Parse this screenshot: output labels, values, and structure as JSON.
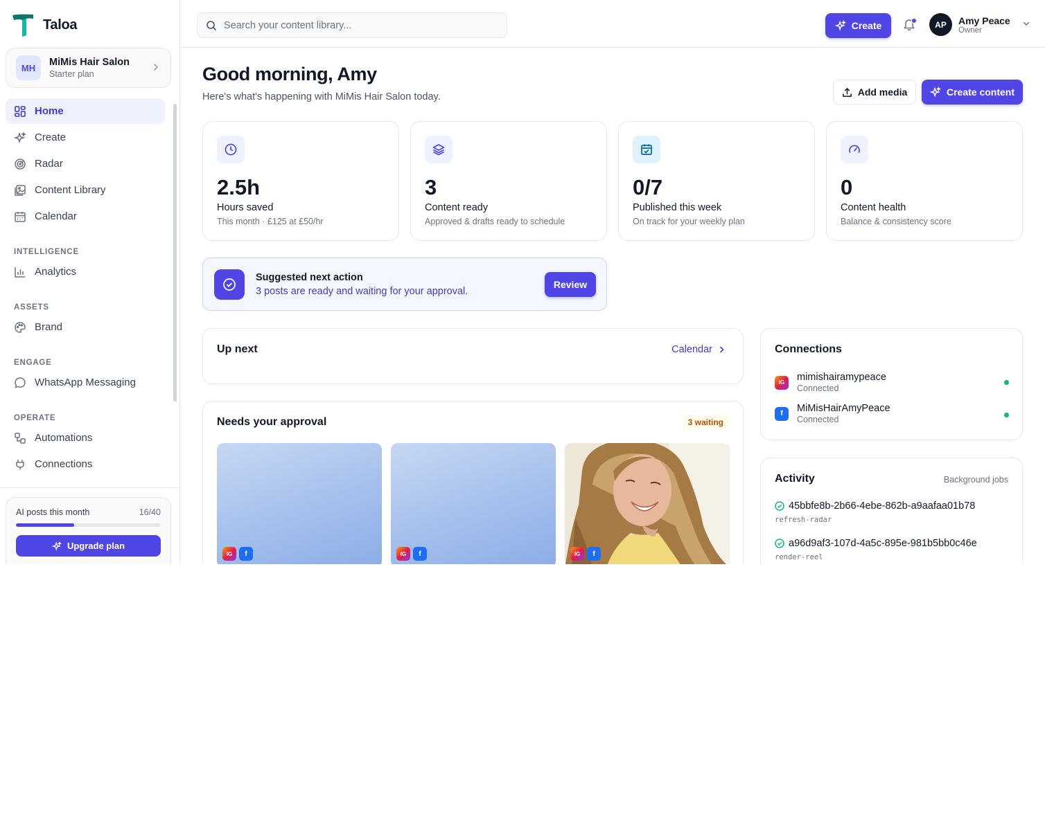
{
  "app": {
    "name": "Taloa"
  },
  "workspace": {
    "initials": "MH",
    "name": "MiMis Hair Salon",
    "plan": "Starter plan"
  },
  "nav": {
    "home": "Home",
    "create": "Create",
    "radar": "Radar",
    "content_library": "Content Library",
    "calendar": "Calendar",
    "section_intelligence": "INTELLIGENCE",
    "analytics": "Analytics",
    "section_assets": "ASSETS",
    "brand": "Brand",
    "section_engage": "ENGAGE",
    "whatsapp": "WhatsApp Messaging",
    "section_operate": "OPERATE",
    "automations": "Automations",
    "connections": "Connections"
  },
  "usage": {
    "label": "AI posts this month",
    "count": "16/40",
    "fraction": 0.4,
    "upgrade_label": "Upgrade plan"
  },
  "header": {
    "search_placeholder": "Search your content library...",
    "create_label": "Create",
    "user": {
      "initials": "AP",
      "name": "Amy Peace",
      "role": "Owner"
    }
  },
  "greeting": {
    "title": "Good morning, Amy",
    "subtitle": "Here's what's happening with MiMis Hair Salon today.",
    "add_media_label": "Add media",
    "create_content_label": "Create content"
  },
  "stats": [
    {
      "value": "2.5h",
      "label": "Hours saved",
      "sub": "This month · £125 at £50/hr",
      "icon": "clock-icon"
    },
    {
      "value": "3",
      "label": "Content ready",
      "sub": "Approved & drafts ready to schedule",
      "icon": "layers-icon"
    },
    {
      "value": "0/7",
      "label": "Published this week",
      "sub": "On track for your weekly plan",
      "icon": "calendar-check-icon"
    },
    {
      "value": "0",
      "label": "Content health",
      "sub": "Balance & consistency score",
      "icon": "gauge-icon"
    }
  ],
  "suggestion": {
    "title": "Suggested next action",
    "text": "3 posts are ready and waiting for your approval.",
    "action_label": "Review"
  },
  "up_next": {
    "title": "Up next",
    "link_label": "Calendar"
  },
  "approval": {
    "title": "Needs your approval",
    "badge": "3 waiting",
    "platform_ig": "IG",
    "platform_fb": "f"
  },
  "connections": {
    "title": "Connections",
    "items": [
      {
        "name": "mimishairamypeace",
        "status": "Connected",
        "platform": "IG"
      },
      {
        "name": "MiMisHairAmyPeace",
        "status": "Connected",
        "platform": "f"
      }
    ]
  },
  "activity": {
    "title": "Activity",
    "subtitle": "Background jobs",
    "items": [
      {
        "id": "45bbfe8b-2b66-4ebe-862b-a9aafaa01b78",
        "job": "refresh-radar"
      },
      {
        "id": "a96d9af3-107d-4a5c-895e-981b5bb0c46e",
        "job": "render-reel"
      }
    ]
  },
  "colors": {
    "accent": "#4f46e5",
    "success": "#10b981",
    "warning": "#b45309"
  }
}
